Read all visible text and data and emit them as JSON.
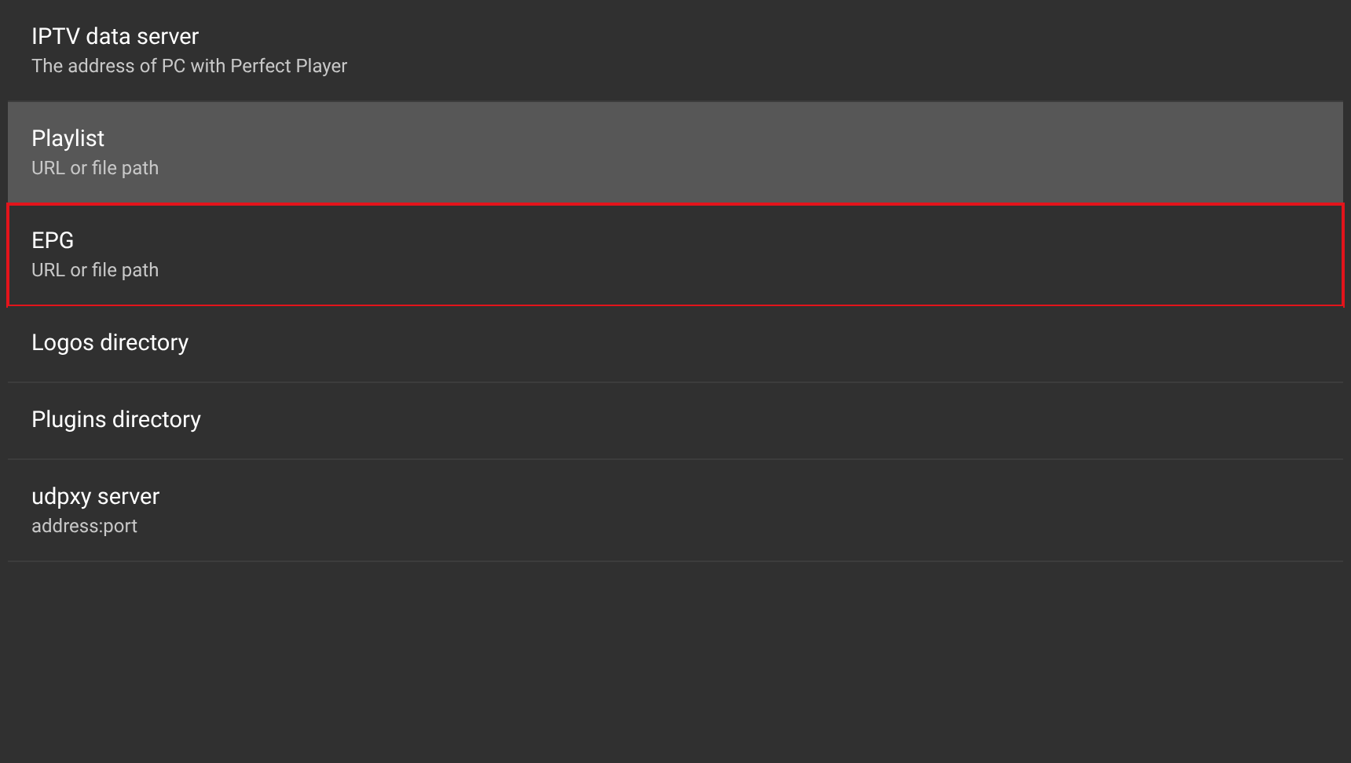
{
  "settings": [
    {
      "title": "IPTV data server",
      "subtitle": "The address of PC with Perfect Player",
      "selected": false,
      "highlighted": false
    },
    {
      "title": "Playlist",
      "subtitle": "URL or file path",
      "selected": true,
      "highlighted": false
    },
    {
      "title": "EPG",
      "subtitle": "URL or file path",
      "selected": false,
      "highlighted": true
    },
    {
      "title": "Logos directory",
      "selected": false,
      "highlighted": false
    },
    {
      "title": "Plugins directory",
      "selected": false,
      "highlighted": false
    },
    {
      "title": "udpxy server",
      "subtitle": "address:port",
      "selected": false,
      "highlighted": false
    }
  ]
}
